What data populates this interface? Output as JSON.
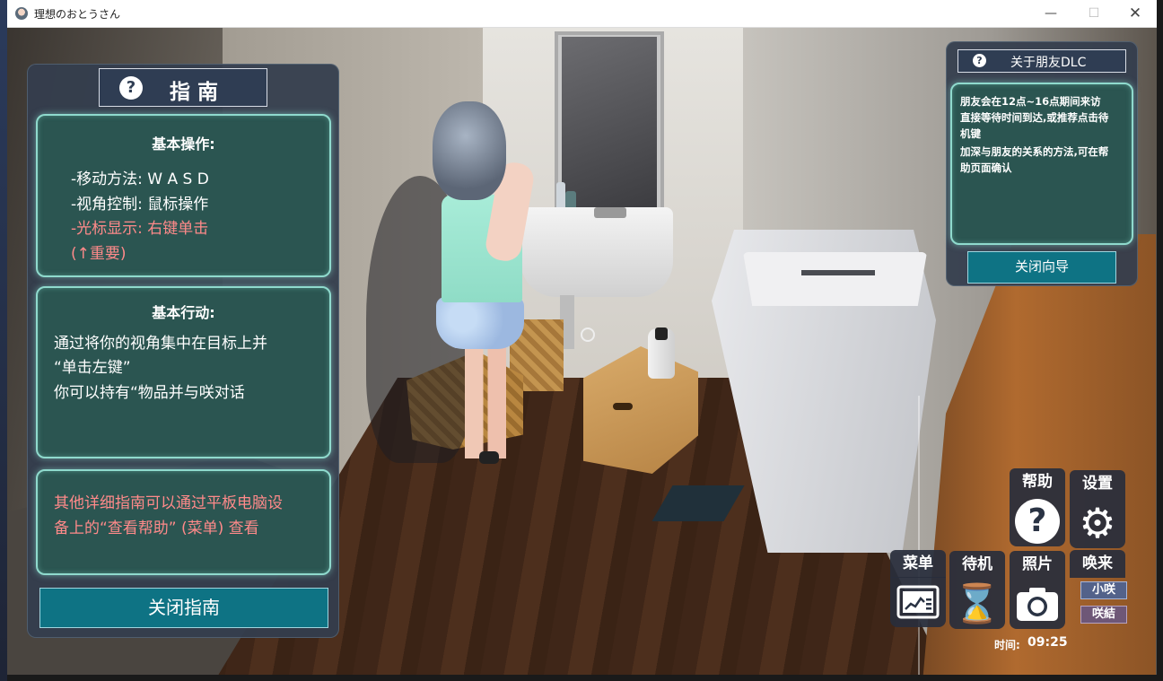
{
  "window": {
    "title": "理想のおとうさん",
    "minimize": "—",
    "maximize": "☐",
    "close": "✕"
  },
  "guide": {
    "title": "指南",
    "question_mark": "?",
    "basic_ops": {
      "heading": "基本操作:",
      "lines": [
        "-移动方法: W A S D",
        "-视角控制: 鼠标操作",
        "-光标显示: 右键单击",
        "(↑重要)"
      ]
    },
    "basic_actions": {
      "heading": "基本行动:",
      "lines": [
        "通过将你的视角集中在目标上并",
        "“单击左键”",
        "你可以持有“物品并与咲对话"
      ]
    },
    "more_info": {
      "lines": [
        "其他详细指南可以通过平板电脑设",
        "备上的“查看帮助” (菜单) 查看"
      ]
    },
    "close_button": "关闭指南"
  },
  "dlc": {
    "title": "关于朋友DLC",
    "question_mark": "?",
    "lines": [
      "朋友会在12点~16点期间来访",
      "直接等待时间到达,或推荐点击待",
      "机键",
      "加深与朋友的关系的方法,可在帮",
      "助页面确认"
    ],
    "close_button": "关闭向导"
  },
  "hud": {
    "help_label": "帮助",
    "help_icon": "?",
    "settings_label": "设置",
    "settings_icon": "⚙",
    "menu_label": "菜单",
    "wait_label": "待机",
    "wait_icon": "⌛",
    "photo_label": "照片",
    "call_label": "唤来",
    "call_option_1": "小咲",
    "call_option_2": "咲結",
    "time_label": "时间:",
    "time_value": "09:25"
  },
  "colors": {
    "panel_bg": "#343e4e",
    "card_bg": "#2b5551",
    "card_glow": "#8fdacd",
    "button_teal": "#0e7384",
    "warning_red": "#ff8a8a"
  }
}
